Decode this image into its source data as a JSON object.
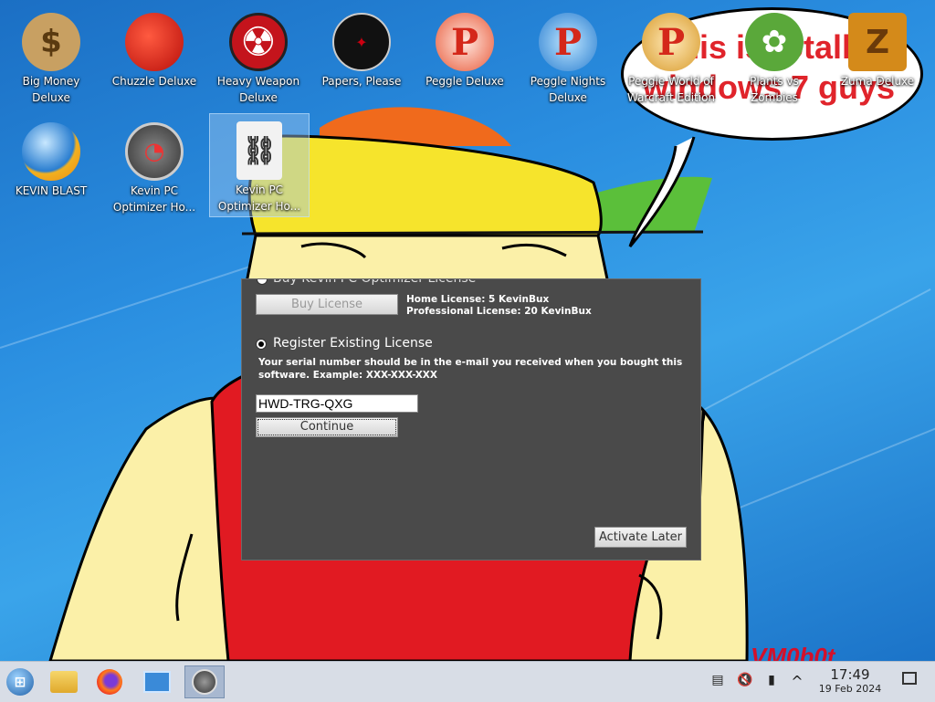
{
  "desktop": {
    "icons": [
      {
        "label": "Big Money Deluxe",
        "icon": "money-bag-icon",
        "glyph": "$",
        "color": "#c8a062"
      },
      {
        "label": "Chuzzle Deluxe",
        "icon": "chuzzle-icon",
        "glyph": "",
        "color": "#d42a1e"
      },
      {
        "label": "Heavy Weapon Deluxe",
        "icon": "radiation-icon",
        "glyph": "☢",
        "color": "#c4141c"
      },
      {
        "label": "Papers, Please",
        "icon": "papers-please-icon",
        "glyph": "",
        "color": "#111111"
      },
      {
        "label": "Peggle Deluxe",
        "icon": "peggle-icon",
        "glyph": "P",
        "color": "#e85a3a"
      },
      {
        "label": "Peggle Nights Deluxe",
        "icon": "peggle-nights-icon",
        "glyph": "P",
        "color": "#3a9ed8"
      },
      {
        "label": "Peggle World of Warcraft Edition",
        "icon": "peggle-wow-icon",
        "glyph": "P",
        "color": "#d89a2a"
      },
      {
        "label": "Plants vs Zombies",
        "icon": "plants-vs-zombies-icon",
        "glyph": "✿",
        "color": "#5aa83a"
      },
      {
        "label": "Zuma Deluxe",
        "icon": "zuma-icon",
        "glyph": "Z",
        "color": "#d48a1a"
      },
      {
        "label": "KEVIN BLAST",
        "icon": "kevin-blast-icon",
        "glyph": "",
        "color": "#2a7ed0"
      },
      {
        "label": "Kevin PC Optimizer Ho...",
        "icon": "speedometer-icon",
        "glyph": "",
        "color": "#666666"
      },
      {
        "label": "Kevin PC Optimizer Ho...",
        "icon": "shortcut-file-icon",
        "glyph": "🔗",
        "color": "#e8e8e8"
      }
    ],
    "speech_bubble": "this is totally windows 7 guys",
    "watermark": "VM0b0t"
  },
  "dialog": {
    "buy_heading": "Buy Kevin PC Optimizer License",
    "buy_button": "Buy License",
    "home_license": "Home License: 5 KevinBux",
    "pro_license": "Professional License: 20 KevinBux",
    "register_label": "Register Existing License",
    "serial_hint_1": "Your serial number should be in the e-mail you received when you bought this",
    "serial_hint_2": "software. Example: XXX-XXX-XXX",
    "serial_value": "HWD-TRG-QXG",
    "continue_button": "Continue",
    "activate_later_button": "Activate Later"
  },
  "taskbar": {
    "apps": [
      {
        "name": "start-button",
        "icon": "windows-start-icon"
      },
      {
        "name": "file-manager",
        "icon": "folder-icon"
      },
      {
        "name": "firefox",
        "icon": "firefox-icon"
      },
      {
        "name": "control-panel",
        "icon": "control-panel-icon"
      },
      {
        "name": "kevin-pc-optimizer",
        "icon": "speedometer-icon"
      }
    ],
    "clock_time": "17:49",
    "clock_date": "19 Feb 2024"
  }
}
